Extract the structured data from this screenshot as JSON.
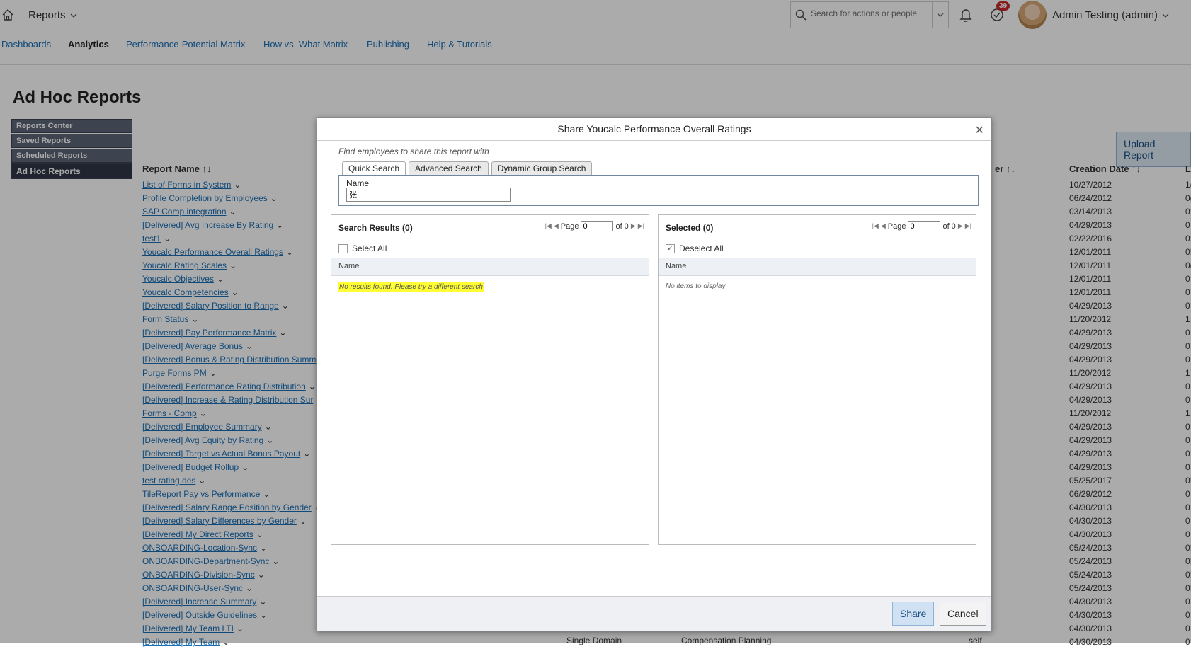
{
  "header": {
    "module": "Reports",
    "search_placeholder": "Search for actions or people",
    "todo_count": "39",
    "user_name": "Admin Testing (admin)"
  },
  "nav": {
    "items": [
      "Dashboards",
      "Analytics",
      "Performance-Potential Matrix",
      "How vs. What Matrix",
      "Publishing",
      "Help & Tutorials"
    ],
    "active": "Analytics"
  },
  "page": {
    "title": "Ad Hoc Reports",
    "side_menu": [
      "Reports Center",
      "Saved Reports",
      "Scheduled Reports",
      "Ad Hoc Reports"
    ],
    "upload_label": "Upload Report",
    "columns": {
      "name": "Report Name",
      "owner_fragment": "er",
      "created": "Creation Date",
      "last_fragment": "L"
    },
    "reports": [
      {
        "name": "List of Forms in System",
        "date": "10/27/2012",
        "last": "1("
      },
      {
        "name": "Profile Completion by Employees",
        "date": "06/24/2012",
        "last": "0("
      },
      {
        "name": "SAP Comp integration",
        "date": "03/14/2013",
        "last": "0:"
      },
      {
        "name": "[Delivered] Avg Increase By Rating",
        "date": "04/29/2013",
        "last": "0"
      },
      {
        "name": "test1",
        "date": "02/22/2016",
        "last": "0:"
      },
      {
        "name": "Youcalc Performance Overall Ratings",
        "date": "12/01/2011",
        "last": "0!"
      },
      {
        "name": "Youcalc Rating Scales",
        "date": "12/01/2011",
        "last": "0("
      },
      {
        "name": "Youcalc Objectives",
        "date": "12/01/2011",
        "last": "0"
      },
      {
        "name": "Youcalc Competencies",
        "date": "12/01/2011",
        "last": "0"
      },
      {
        "name": "[Delivered] Salary Position to Range",
        "date": "04/29/2013",
        "last": "0"
      },
      {
        "name": "Form Status",
        "date": "11/20/2012",
        "last": "1"
      },
      {
        "name": "[Delivered] Pay  Performance Matrix",
        "date": "04/29/2013",
        "last": "0"
      },
      {
        "name": "[Delivered] Average Bonus",
        "date": "04/29/2013",
        "last": "0"
      },
      {
        "name": "[Delivered] Bonus & Rating Distribution Summ",
        "date": "04/29/2013",
        "last": "0"
      },
      {
        "name": "Purge Forms PM",
        "date": "11/20/2012",
        "last": "1"
      },
      {
        "name": "[Delivered] Performance Rating Distribution",
        "date": "04/29/2013",
        "last": "0"
      },
      {
        "name": "[Delivered] Increase & Rating Distribution Sur",
        "date": "04/29/2013",
        "last": "0"
      },
      {
        "name": "Forms - Comp",
        "date": "11/20/2012",
        "last": "1"
      },
      {
        "name": "[Delivered] Employee Summary",
        "date": "04/29/2013",
        "last": "0"
      },
      {
        "name": "[Delivered] Avg Equity by Rating",
        "date": "04/29/2013",
        "last": "0"
      },
      {
        "name": "[Delivered] Target vs Actual Bonus Payout",
        "date": "04/29/2013",
        "last": "0"
      },
      {
        "name": "[Delivered] Budget Rollup",
        "date": "04/29/2013",
        "last": "0"
      },
      {
        "name": "test rating des",
        "date": "05/25/2017",
        "last": "0!"
      },
      {
        "name": "TileReport Pay vs Performance",
        "date": "06/29/2012",
        "last": "0"
      },
      {
        "name": "[Delivered] Salary Range Position by Gender",
        "date": "04/30/2013",
        "last": "0"
      },
      {
        "name": "[Delivered] Salary Differences by Gender",
        "date": "04/30/2013",
        "last": "0"
      },
      {
        "name": "[Delivered] My Direct Reports",
        "date": "04/30/2013",
        "last": "0"
      },
      {
        "name": "ONBOARDING-Location-Sync",
        "date": "05/24/2013",
        "last": "0!"
      },
      {
        "name": "ONBOARDING-Department-Sync",
        "date": "05/24/2013",
        "last": "0!"
      },
      {
        "name": "ONBOARDING-Division-Sync",
        "date": "05/24/2013",
        "last": "0!"
      },
      {
        "name": "ONBOARDING-User-Sync",
        "date": "05/24/2013",
        "last": "0!"
      },
      {
        "name": "[Delivered] Increase Summary",
        "date": "04/30/2013",
        "last": "0"
      },
      {
        "name": "[Delivered] Outside Guidelines",
        "date": "04/30/2013",
        "last": "0"
      },
      {
        "name": "[Delivered] My Team LTI",
        "date": "04/30/2013",
        "last": "0"
      },
      {
        "name": "[Delivered] My Team",
        "date": "04/30/2013",
        "last": "0"
      }
    ],
    "last_row_extra": {
      "domain": "Single Domain",
      "category": "Compensation Planning",
      "owner": "self"
    }
  },
  "dialog": {
    "title": "Share Youcalc Performance Overall Ratings",
    "hint": "Find employees to share this report with",
    "tabs": [
      "Quick Search",
      "Advanced Search",
      "Dynamic Group Search"
    ],
    "name_label": "Name",
    "name_value": "张",
    "left": {
      "title": "Search Results (0)",
      "page_label": "Page",
      "page_value": "0",
      "of_label": "of 0",
      "select_label": "Select All",
      "col_name": "Name",
      "message": "No results found. Please try a different search"
    },
    "right": {
      "title": "Selected (0)",
      "page_label": "Page",
      "page_value": "0",
      "of_label": "of 0",
      "select_label": "Deselect All",
      "col_name": "Name",
      "message": "No items to display"
    },
    "share_label": "Share",
    "cancel_label": "Cancel"
  }
}
